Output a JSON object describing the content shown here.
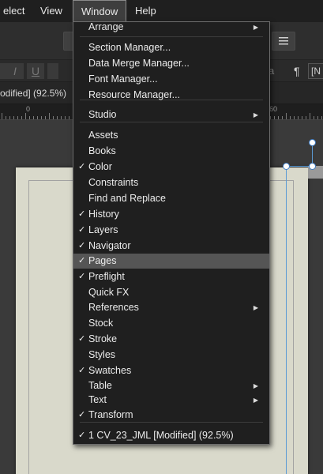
{
  "menubar": {
    "items": [
      "elect",
      "View",
      "Window",
      "Help"
    ]
  },
  "contextbar": {
    "italic": "I",
    "underline": "U",
    "pilcrow": "¶",
    "right_partial": "[N",
    "a_partial": "a"
  },
  "doctab": {
    "title": "odified] (92.5%)"
  },
  "ruler": {
    "labels": [
      "0",
      "60"
    ]
  },
  "menu": {
    "items": [
      {
        "label": "Arrange",
        "checked": false,
        "submenu": true
      },
      {
        "label": "Section Manager...",
        "checked": false,
        "submenu": false
      },
      {
        "label": "Data Merge Manager...",
        "checked": false,
        "submenu": false
      },
      {
        "label": "Font Manager...",
        "checked": false,
        "submenu": false
      },
      {
        "label": "Resource Manager...",
        "checked": false,
        "submenu": false
      },
      {
        "label": "Studio",
        "checked": false,
        "submenu": true
      },
      {
        "label": "Assets",
        "checked": false,
        "submenu": false
      },
      {
        "label": "Books",
        "checked": false,
        "submenu": false
      },
      {
        "label": "Color",
        "checked": true,
        "submenu": false
      },
      {
        "label": "Constraints",
        "checked": false,
        "submenu": false
      },
      {
        "label": "Find and Replace",
        "checked": false,
        "submenu": false
      },
      {
        "label": "History",
        "checked": true,
        "submenu": false
      },
      {
        "label": "Layers",
        "checked": true,
        "submenu": false
      },
      {
        "label": "Navigator",
        "checked": true,
        "submenu": false
      },
      {
        "label": "Pages",
        "checked": true,
        "submenu": false,
        "highlighted": true
      },
      {
        "label": "Preflight",
        "checked": true,
        "submenu": false
      },
      {
        "label": "Quick FX",
        "checked": false,
        "submenu": false
      },
      {
        "label": "References",
        "checked": false,
        "submenu": true
      },
      {
        "label": "Stock",
        "checked": false,
        "submenu": false
      },
      {
        "label": "Stroke",
        "checked": true,
        "submenu": false
      },
      {
        "label": "Styles",
        "checked": false,
        "submenu": false
      },
      {
        "label": "Swatches",
        "checked": true,
        "submenu": false
      },
      {
        "label": "Table",
        "checked": false,
        "submenu": true
      },
      {
        "label": "Text",
        "checked": false,
        "submenu": true
      },
      {
        "label": "Transform",
        "checked": true,
        "submenu": false
      },
      {
        "label": "1 CV_23_JML [Modified] (92.5%)",
        "checked": true,
        "submenu": false
      }
    ],
    "check_glyph": "✓",
    "submenu_glyph": "▶"
  },
  "colors": {
    "menu_bg": "#1f1f1f",
    "highlight": "#555555",
    "selection": "#5b9bd5",
    "paper": "#d9d9cb"
  }
}
